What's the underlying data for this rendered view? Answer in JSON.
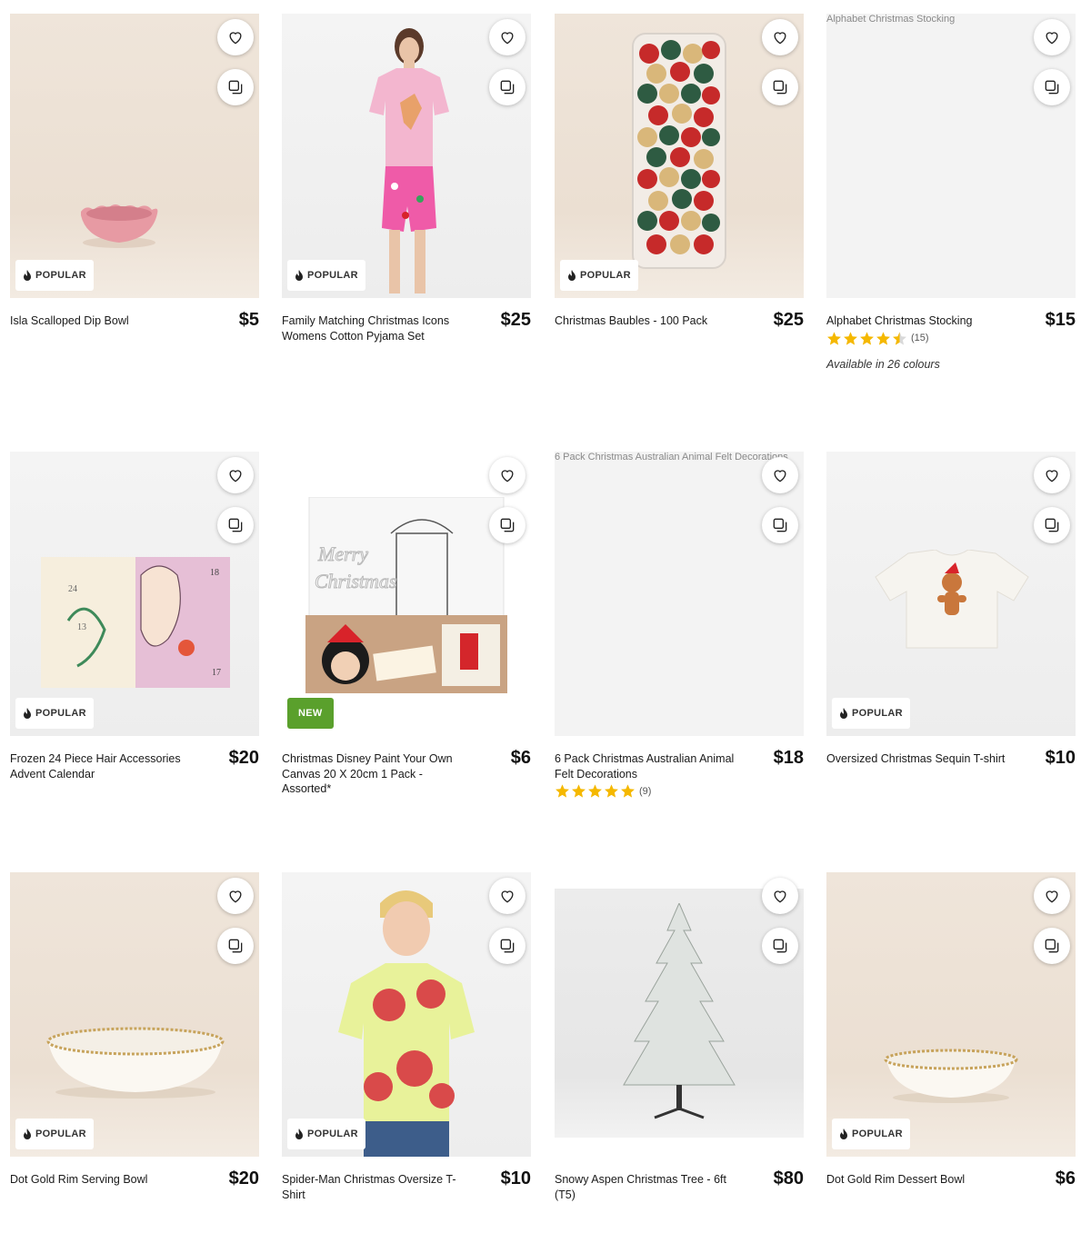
{
  "products": [
    {
      "name": "Isla Scalloped Dip Bowl",
      "price": "$5",
      "badge": "POPULAR"
    },
    {
      "name": "Family Matching Christmas Icons Womens Cotton Pyjama Set",
      "price": "$25",
      "badge": "POPULAR"
    },
    {
      "name": "Christmas Baubles - 100 Pack",
      "price": "$25",
      "badge": "POPULAR"
    },
    {
      "name": "Alphabet Christmas Stocking",
      "price": "$15",
      "image_alt": "Alphabet Christmas Stocking",
      "rating": 4.5,
      "review_count": "(15)",
      "availability": "Available in 26 colours"
    },
    {
      "name": "Frozen 24 Piece Hair Accessories Advent Calendar",
      "price": "$20",
      "badge": "POPULAR"
    },
    {
      "name": "Christmas Disney Paint Your Own Canvas 20 X 20cm 1 Pack - Assorted*",
      "price": "$6",
      "badge": "NEW"
    },
    {
      "name": "6 Pack Christmas Australian Animal Felt Decorations",
      "price": "$18",
      "image_alt": "6 Pack Christmas Australian Animal Felt Decorations",
      "rating": 5,
      "review_count": "(9)"
    },
    {
      "name": "Oversized Christmas Sequin T-shirt",
      "price": "$10",
      "badge": "POPULAR"
    },
    {
      "name": "Dot Gold Rim Serving Bowl",
      "price": "$20",
      "badge": "POPULAR"
    },
    {
      "name": "Spider-Man Christmas Oversize T-Shirt",
      "price": "$10",
      "badge": "POPULAR"
    },
    {
      "name": "Snowy Aspen Christmas Tree - 6ft (T5)",
      "price": "$80"
    },
    {
      "name": "Dot Gold Rim Dessert Bowl",
      "price": "$6",
      "badge": "POPULAR"
    }
  ],
  "icons": {
    "wishlist": "heart-icon",
    "compare": "compare-icon",
    "popular": "flame-icon",
    "rating": "star-icon"
  },
  "colors": {
    "new_badge": "#5aa02c",
    "star": "#f5b800"
  }
}
